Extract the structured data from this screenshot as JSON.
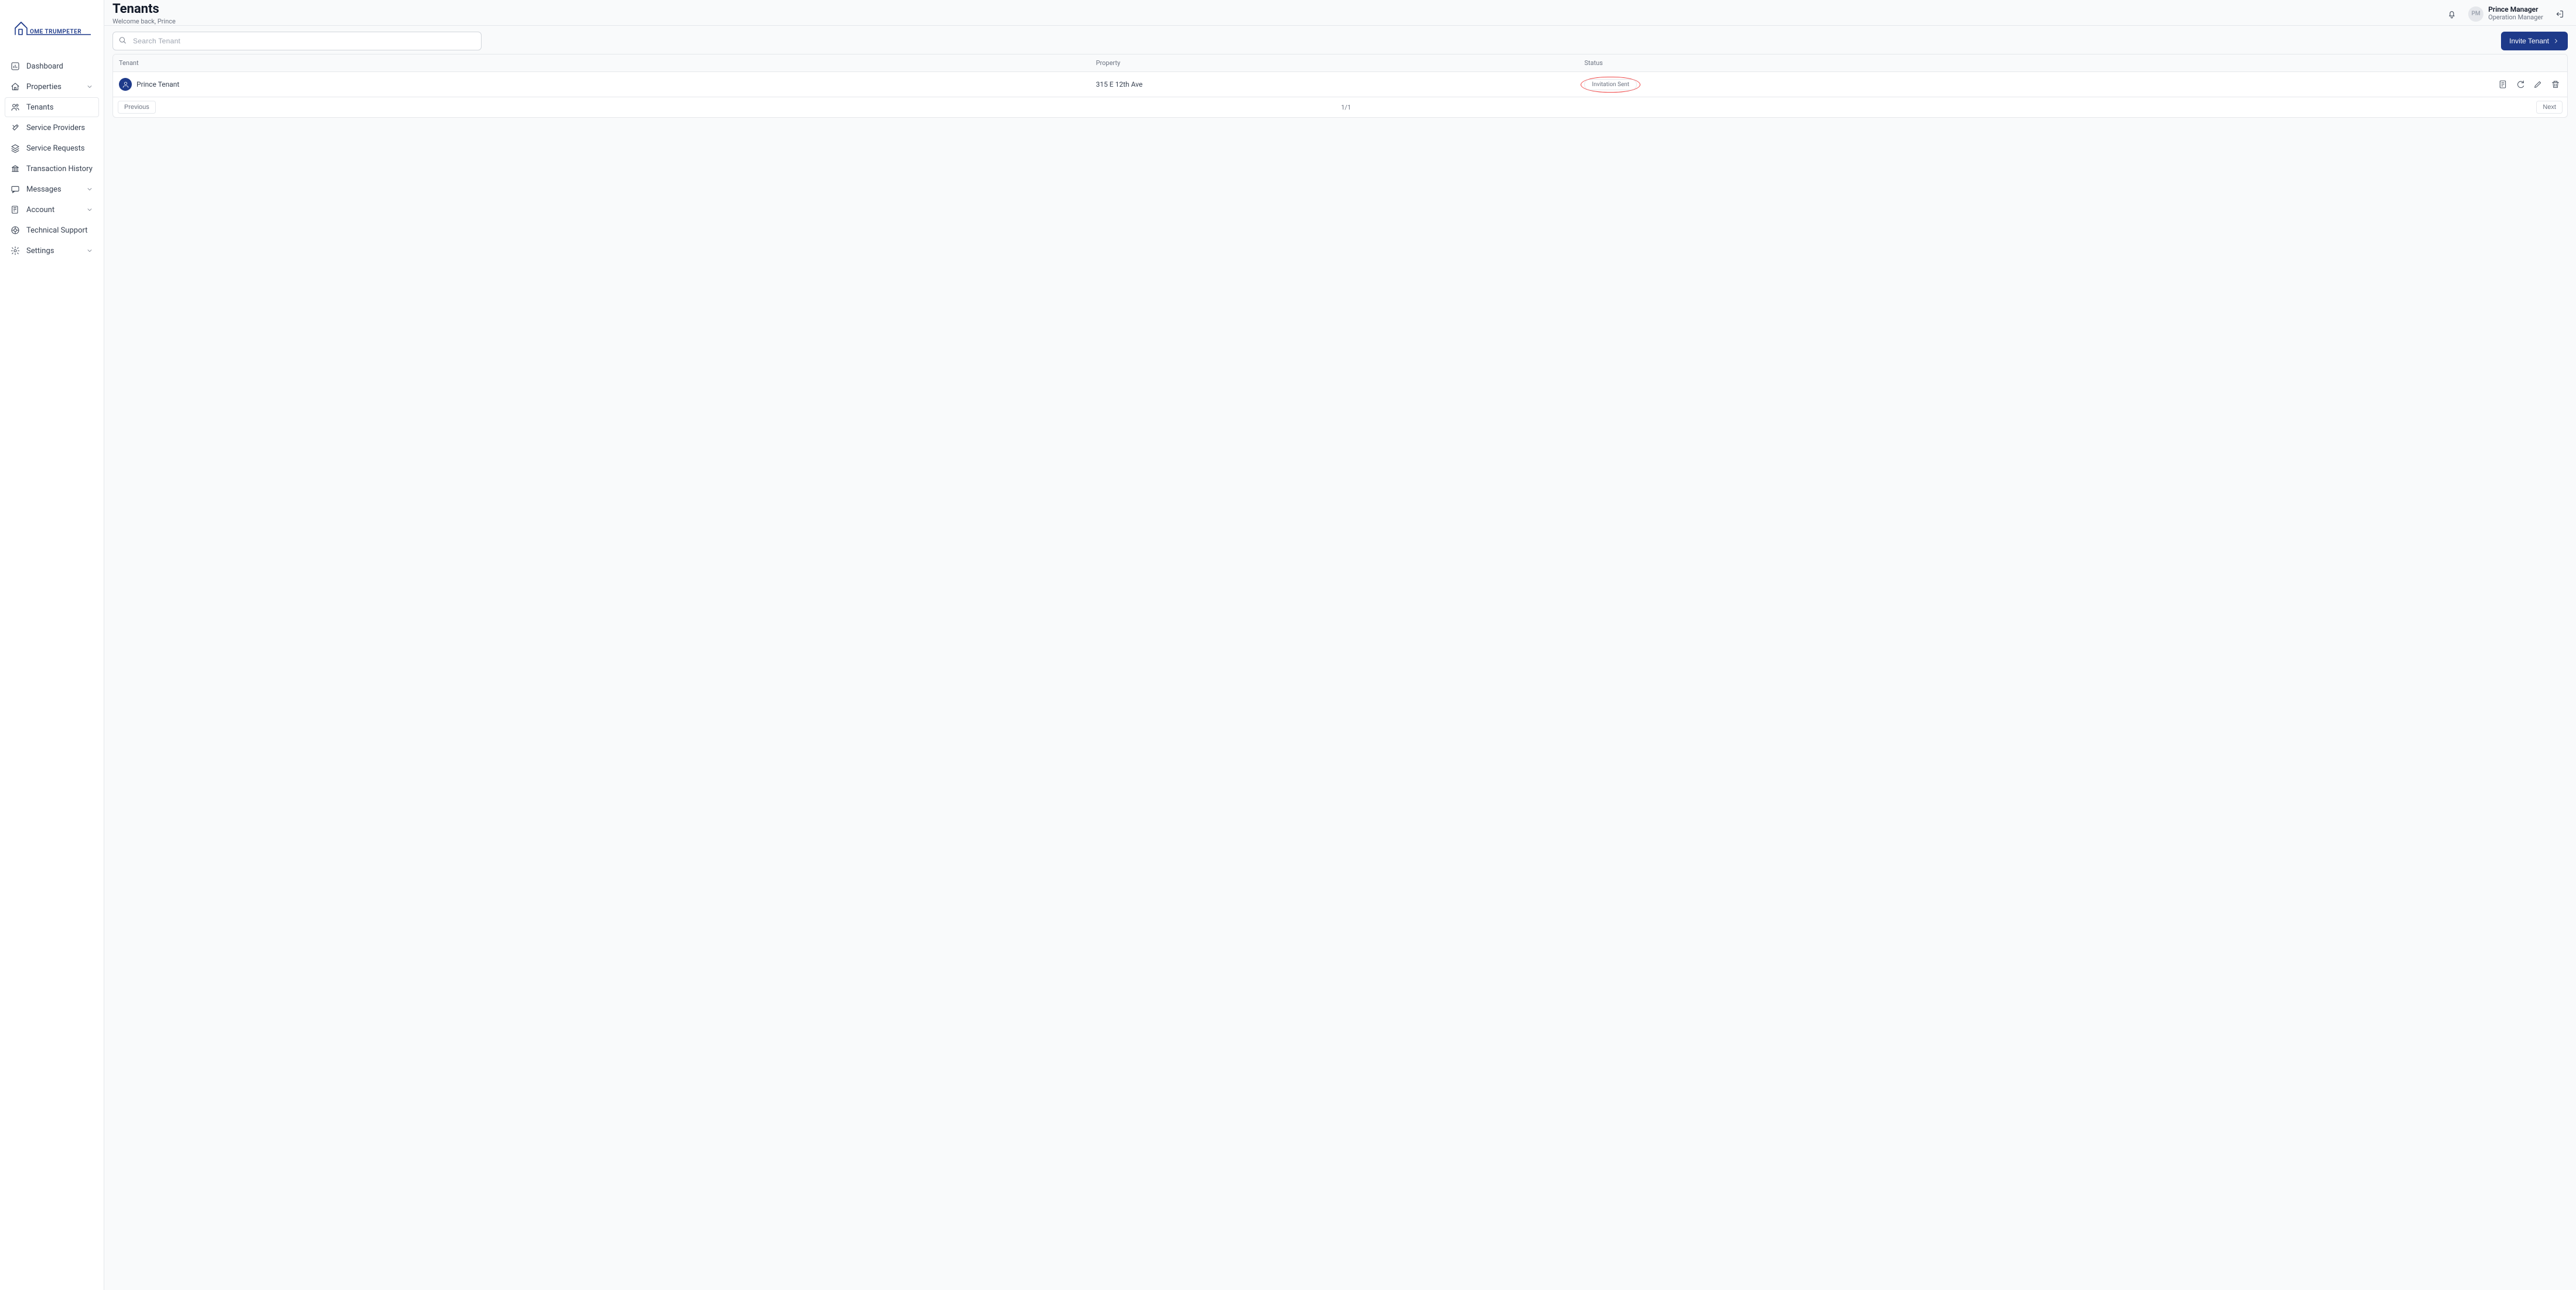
{
  "brand": {
    "name_part1": "OME",
    "name_part2": "TRUMPETER"
  },
  "header": {
    "title": "Tenants",
    "subtitle": "Welcome back, Prince",
    "user_name": "Prince Manager",
    "user_role": "Operation Manager",
    "avatar_initials": "PM"
  },
  "sidebar": {
    "items": [
      {
        "label": "Dashboard",
        "icon": "dashboard",
        "expandable": false,
        "active": false
      },
      {
        "label": "Properties",
        "icon": "home",
        "expandable": true,
        "active": false
      },
      {
        "label": "Tenants",
        "icon": "tenants",
        "expandable": false,
        "active": true
      },
      {
        "label": "Service Providers",
        "icon": "tools",
        "expandable": false,
        "active": false
      },
      {
        "label": "Service Requests",
        "icon": "layers",
        "expandable": false,
        "active": false
      },
      {
        "label": "Transaction History",
        "icon": "bank",
        "expandable": false,
        "active": false
      },
      {
        "label": "Messages",
        "icon": "message",
        "expandable": true,
        "active": false
      },
      {
        "label": "Account",
        "icon": "account",
        "expandable": true,
        "active": false
      },
      {
        "label": "Technical Support",
        "icon": "support",
        "expandable": false,
        "active": false
      },
      {
        "label": "Settings",
        "icon": "settings",
        "expandable": true,
        "active": false
      }
    ]
  },
  "toolbar": {
    "search_placeholder": "Search Tenant",
    "invite_label": "Invite Tenant"
  },
  "table": {
    "columns": {
      "tenant": "Tenant",
      "property": "Property",
      "status": "Status"
    },
    "rows": [
      {
        "name": "Prince Tenant",
        "property": "315 E 12th Ave",
        "status": "Invitation Sent"
      }
    ],
    "pagination": {
      "prev": "Previous",
      "next": "Next",
      "indicator": "1/1"
    }
  }
}
